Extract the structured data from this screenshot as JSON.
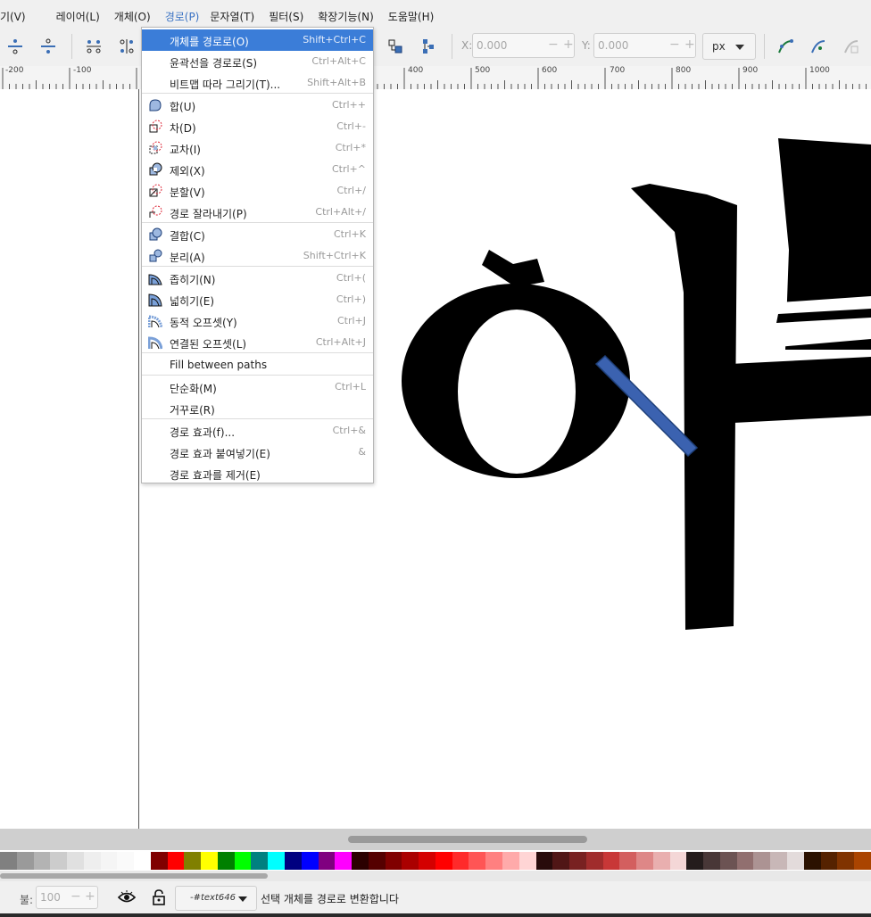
{
  "menubar": {
    "items": [
      "기(V)",
      "레이어(L)",
      "개체(O)",
      "경로(P)",
      "문자열(T)",
      "필터(S)",
      "확장기능(N)",
      "도움말(H)"
    ]
  },
  "toolbar": {
    "x_label": "X:",
    "x_value": "0.000",
    "y_label": "Y:",
    "y_value": "0.000",
    "unit": "px"
  },
  "ruler": {
    "labels": [
      "-200",
      "-100",
      "400",
      "500",
      "600",
      "700",
      "800",
      "900",
      "1000"
    ]
  },
  "path_menu": {
    "items": [
      {
        "label": "개체를 경로로(O)",
        "shortcut": "Shift+Ctrl+C",
        "icon": "object-to-path-icon",
        "highlighted": true
      },
      {
        "label": "윤곽선을 경로로(S)",
        "shortcut": "Ctrl+Alt+C",
        "icon": ""
      },
      {
        "label": "비트맵 따라 그리기(T)...",
        "shortcut": "Shift+Alt+B",
        "icon": ""
      },
      {
        "label": "합(U)",
        "shortcut": "Ctrl++",
        "icon": "union-icon"
      },
      {
        "label": "차(D)",
        "shortcut": "Ctrl+-",
        "icon": "difference-icon"
      },
      {
        "label": "교차(I)",
        "shortcut": "Ctrl+*",
        "icon": "intersection-icon"
      },
      {
        "label": "제외(X)",
        "shortcut": "Ctrl+^",
        "icon": "exclusion-icon"
      },
      {
        "label": "분할(V)",
        "shortcut": "Ctrl+/",
        "icon": "division-icon"
      },
      {
        "label": "경로 잘라내기(P)",
        "shortcut": "Ctrl+Alt+/",
        "icon": "cut-path-icon"
      },
      {
        "label": "결합(C)",
        "shortcut": "Ctrl+K",
        "icon": "combine-icon"
      },
      {
        "label": "분리(A)",
        "shortcut": "Shift+Ctrl+K",
        "icon": "break-apart-icon"
      },
      {
        "label": "좁히기(N)",
        "shortcut": "Ctrl+(",
        "icon": "inset-icon"
      },
      {
        "label": "넓히기(E)",
        "shortcut": "Ctrl+)",
        "icon": "outset-icon"
      },
      {
        "label": "동적 오프셋(Y)",
        "shortcut": "Ctrl+J",
        "icon": "dynamic-offset-icon"
      },
      {
        "label": "연결된 오프셋(L)",
        "shortcut": "Ctrl+Alt+J",
        "icon": "linked-offset-icon"
      },
      {
        "label": "Fill between paths",
        "shortcut": "",
        "icon": ""
      },
      {
        "label": "단순화(M)",
        "shortcut": "Ctrl+L",
        "icon": ""
      },
      {
        "label": "거꾸로(R)",
        "shortcut": "",
        "icon": ""
      },
      {
        "label": "경로 효과(f)...",
        "shortcut": "Ctrl+&",
        "icon": ""
      },
      {
        "label": "경로 효과 붙여넣기(E)",
        "shortcut": "&",
        "icon": ""
      },
      {
        "label": "경로 효과를 제거(E)",
        "shortcut": "",
        "icon": ""
      }
    ]
  },
  "palette": {
    "colors": [
      "#808080",
      "#9a9a9a",
      "#b3b3b3",
      "#cccccc",
      "#e0e0e0",
      "#eeeeee",
      "#f5f5f5",
      "#fafafa",
      "#ffffff",
      "#800000",
      "#ff0000",
      "#808000",
      "#ffff00",
      "#008000",
      "#00ff00",
      "#008080",
      "#00ffff",
      "#000080",
      "#0000ff",
      "#800080",
      "#ff00ff",
      "#2b0000",
      "#550000",
      "#800000",
      "#aa0000",
      "#d40000",
      "#ff0000",
      "#ff2a2a",
      "#ff5555",
      "#ff8080",
      "#ffaaaa",
      "#ffd5d5",
      "#280b0b",
      "#501616",
      "#782121",
      "#a02c2c",
      "#c83737",
      "#d35f5f",
      "#de8787",
      "#e9afaf",
      "#f4d7d7",
      "#241c1c",
      "#483737",
      "#6c5353",
      "#916f6f",
      "#ac9393",
      "#c8b7b7",
      "#e3dbdb",
      "#2b1100",
      "#552200",
      "#803300",
      "#aa4400"
    ]
  },
  "statusbar": {
    "opacity_label": "불:",
    "opacity_value": "100",
    "layer_name": "-#text646",
    "message": "선택 개체를 경로로 변환합니다"
  }
}
